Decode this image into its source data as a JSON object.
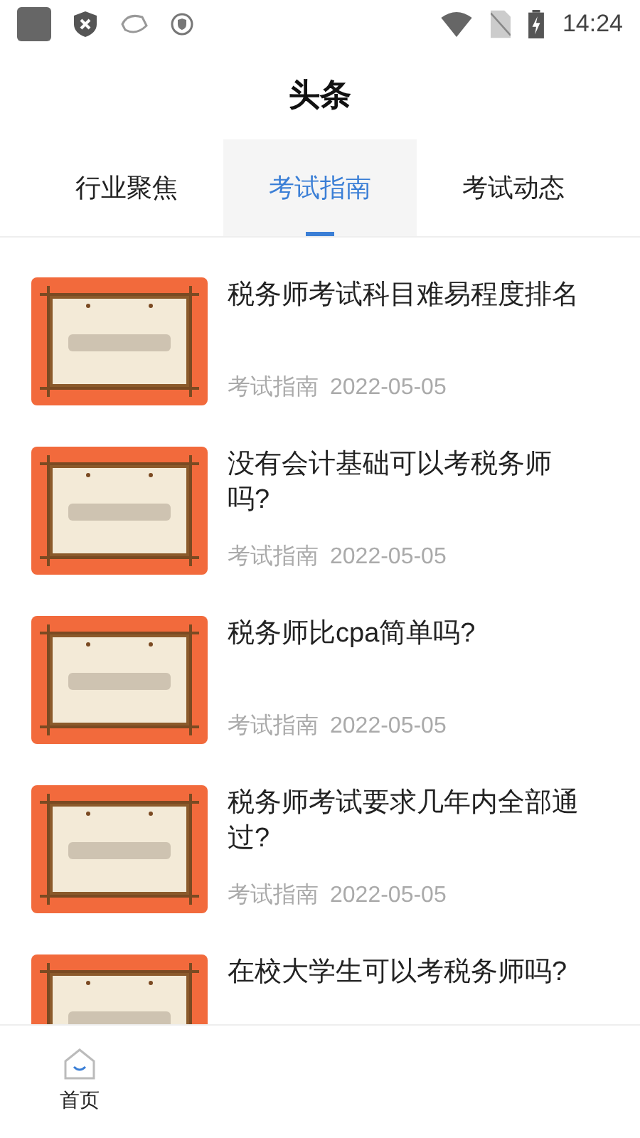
{
  "status_bar": {
    "time": "14:24"
  },
  "header": {
    "title": "头条"
  },
  "tabs": [
    {
      "label": "行业聚焦",
      "selected": false
    },
    {
      "label": "考试指南",
      "selected": true
    },
    {
      "label": "考试动态",
      "selected": false
    }
  ],
  "articles": [
    {
      "title": "税务师考试科目难易程度排名",
      "category": "考试指南",
      "date": "2022-05-05"
    },
    {
      "title": "没有会计基础可以考税务师吗?",
      "category": "考试指南",
      "date": "2022-05-05"
    },
    {
      "title": "税务师比cpa简单吗?",
      "category": "考试指南",
      "date": "2022-05-05"
    },
    {
      "title": "税务师考试要求几年内全部通过?",
      "category": "考试指南",
      "date": "2022-05-05"
    },
    {
      "title": "在校大学生可以考税务师吗?"
    }
  ],
  "bottom_nav": [
    {
      "label": "首页"
    }
  ]
}
